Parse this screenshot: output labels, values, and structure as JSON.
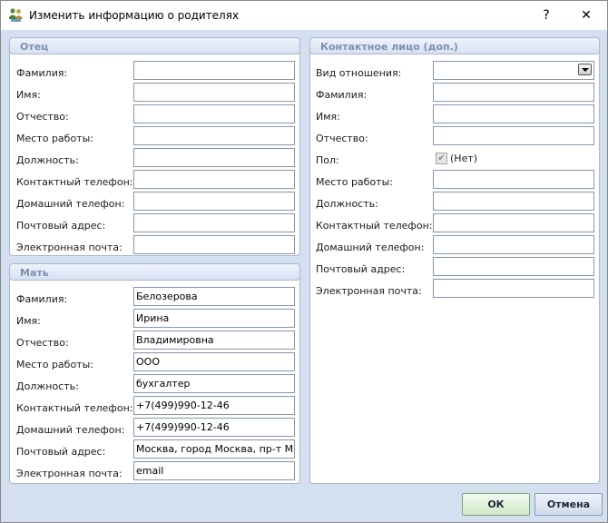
{
  "window": {
    "title": "Изменить информацию о родителях",
    "help_label": "?",
    "close_label": "✕"
  },
  "father": {
    "header": "Отец",
    "labels": [
      "Фамилия:",
      "Имя:",
      "Отчество:",
      "Место работы:",
      "Должность:",
      "Контактный телефон:",
      "Домашний телефон:",
      "Почтовый адрес:",
      "Электронная почта:"
    ],
    "values": [
      "",
      "",
      "",
      "",
      "",
      "",
      "",
      "",
      ""
    ]
  },
  "mother": {
    "header": "Мать",
    "labels": [
      "Фамилия:",
      "Имя:",
      "Отчество:",
      "Место работы:",
      "Должность:",
      "Контактный телефон:",
      "Домашний телефон:",
      "Почтовый адрес:",
      "Электронная почта:"
    ],
    "values": [
      "Белозерова",
      "Ирина",
      "Владимировна",
      "ООО",
      "бухгалтер",
      "+7(499)990-12-46",
      "+7(499)990-12-46",
      "Москва, город Москва, пр-т Мира,",
      "email"
    ]
  },
  "contact": {
    "header": "Контактное лицо (доп.)",
    "relation_label": "Вид отношения:",
    "relation_value": "",
    "labels": [
      "Фамилия:",
      "Имя:",
      "Отчество:"
    ],
    "values": [
      "",
      "",
      ""
    ],
    "gender_label": "Пол:",
    "gender_checked": true,
    "gender_text": "(Нет)",
    "labels2": [
      "Место работы:",
      "Должность:",
      "Контактный телефон:",
      "Домашний телефон:",
      "Почтовый адрес:",
      "Электронная почта:"
    ],
    "values2": [
      "",
      "",
      "",
      "",
      "",
      ""
    ]
  },
  "buttons": {
    "ok": "ОК",
    "cancel": "Отмена"
  }
}
